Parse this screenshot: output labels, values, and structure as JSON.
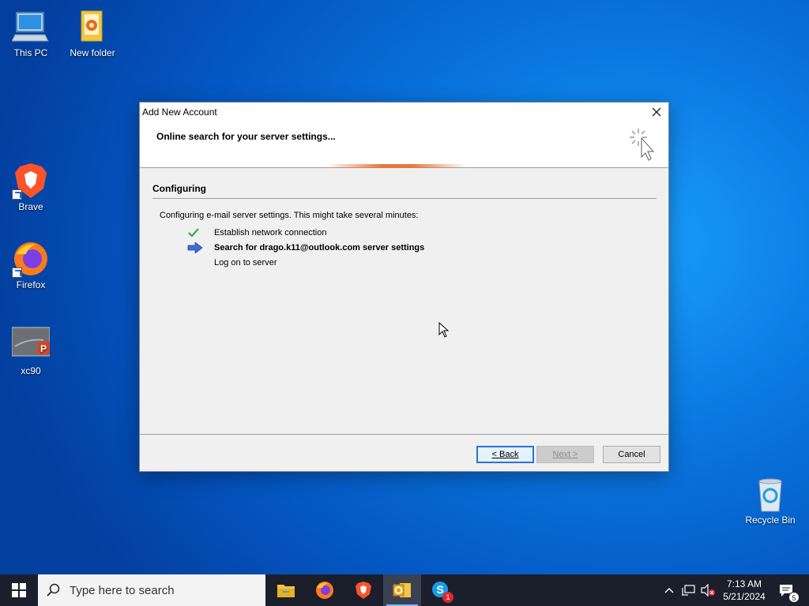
{
  "desktop": {
    "icons": [
      {
        "label": "This PC"
      },
      {
        "label": "New folder"
      },
      {
        "label": "Brave"
      },
      {
        "label": "Firefox"
      },
      {
        "label": "xc90"
      },
      {
        "label": "Recycle Bin"
      }
    ]
  },
  "dialog": {
    "title": "Add New Account",
    "header_title": "Online search for your server settings...",
    "section_title": "Configuring",
    "description": "Configuring e-mail server settings. This might take several minutes:",
    "steps": [
      {
        "label": "Establish network connection",
        "status": "done"
      },
      {
        "label": "Search for drago.k11@outlook.com server settings",
        "status": "active"
      },
      {
        "label": "Log on to server",
        "status": "pending"
      }
    ],
    "buttons": {
      "back": "< Back",
      "next": "Next >",
      "cancel": "Cancel"
    }
  },
  "taskbar": {
    "search_placeholder": "Type here to search",
    "apps": [
      "File Explorer",
      "Firefox",
      "Brave",
      "Outlook",
      "Skype"
    ],
    "skype_badge": "1",
    "time": "7:13 AM",
    "date": "5/21/2024",
    "notification_count": "5"
  },
  "colors": {
    "accent": "#2a74d8",
    "taskbar": "#1a1f2b",
    "check": "#3aa846",
    "arrow": "#3b6fd6"
  }
}
